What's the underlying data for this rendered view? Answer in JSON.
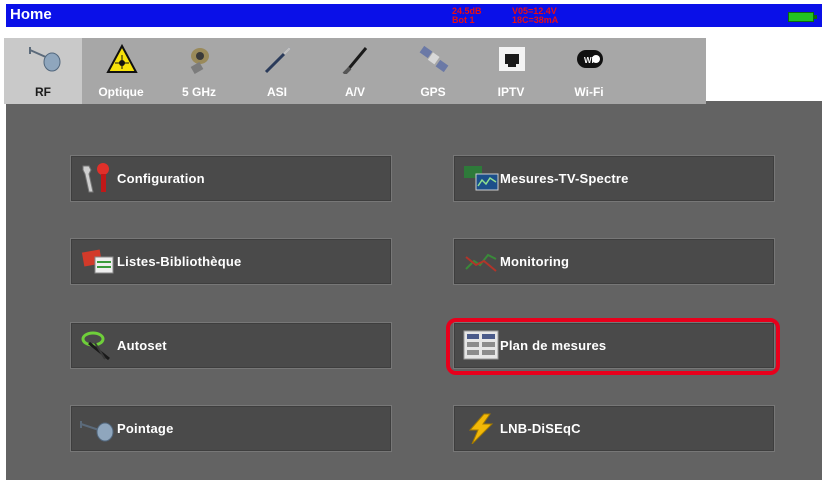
{
  "window": {
    "title": "Home"
  },
  "status": {
    "line1": "24.5dB",
    "line2": "Bot 1",
    "line3": "V05=12.4V",
    "line4": "18C=38mA",
    "text_color": "#e80e14"
  },
  "colors": {
    "titlebar": "#0a10e8",
    "panel": "#636363",
    "button": "#4a4a4a",
    "highlight": "#e8001c",
    "battery": "#22c422"
  },
  "tabs": [
    {
      "label": "RF",
      "icon": "dish-icon",
      "active": true
    },
    {
      "label": "Optique",
      "icon": "laser-warning-icon",
      "active": false
    },
    {
      "label": "5 GHz",
      "icon": "connector-icon",
      "active": false
    },
    {
      "label": "ASI",
      "icon": "probe-icon",
      "active": false
    },
    {
      "label": "A/V",
      "icon": "cable-icon",
      "active": false
    },
    {
      "label": "GPS",
      "icon": "satellite-icon",
      "active": false
    },
    {
      "label": "IPTV",
      "icon": "ethernet-port-icon",
      "active": false
    },
    {
      "label": "Wi-Fi",
      "icon": "wifi-icon",
      "active": false
    }
  ],
  "menu": {
    "configuration": "Configuration",
    "mesures_tv_spectre": "Mesures-TV-Spectre",
    "listes_bibliotheque": "Listes-Bibliothèque",
    "monitoring": "Monitoring",
    "autoset": "Autoset",
    "plan_de_mesures": "Plan de mesures",
    "pointage": "Pointage",
    "lnb_diseqc": "LNB-DiSEqC"
  },
  "highlighted_item": "Plan de mesures"
}
